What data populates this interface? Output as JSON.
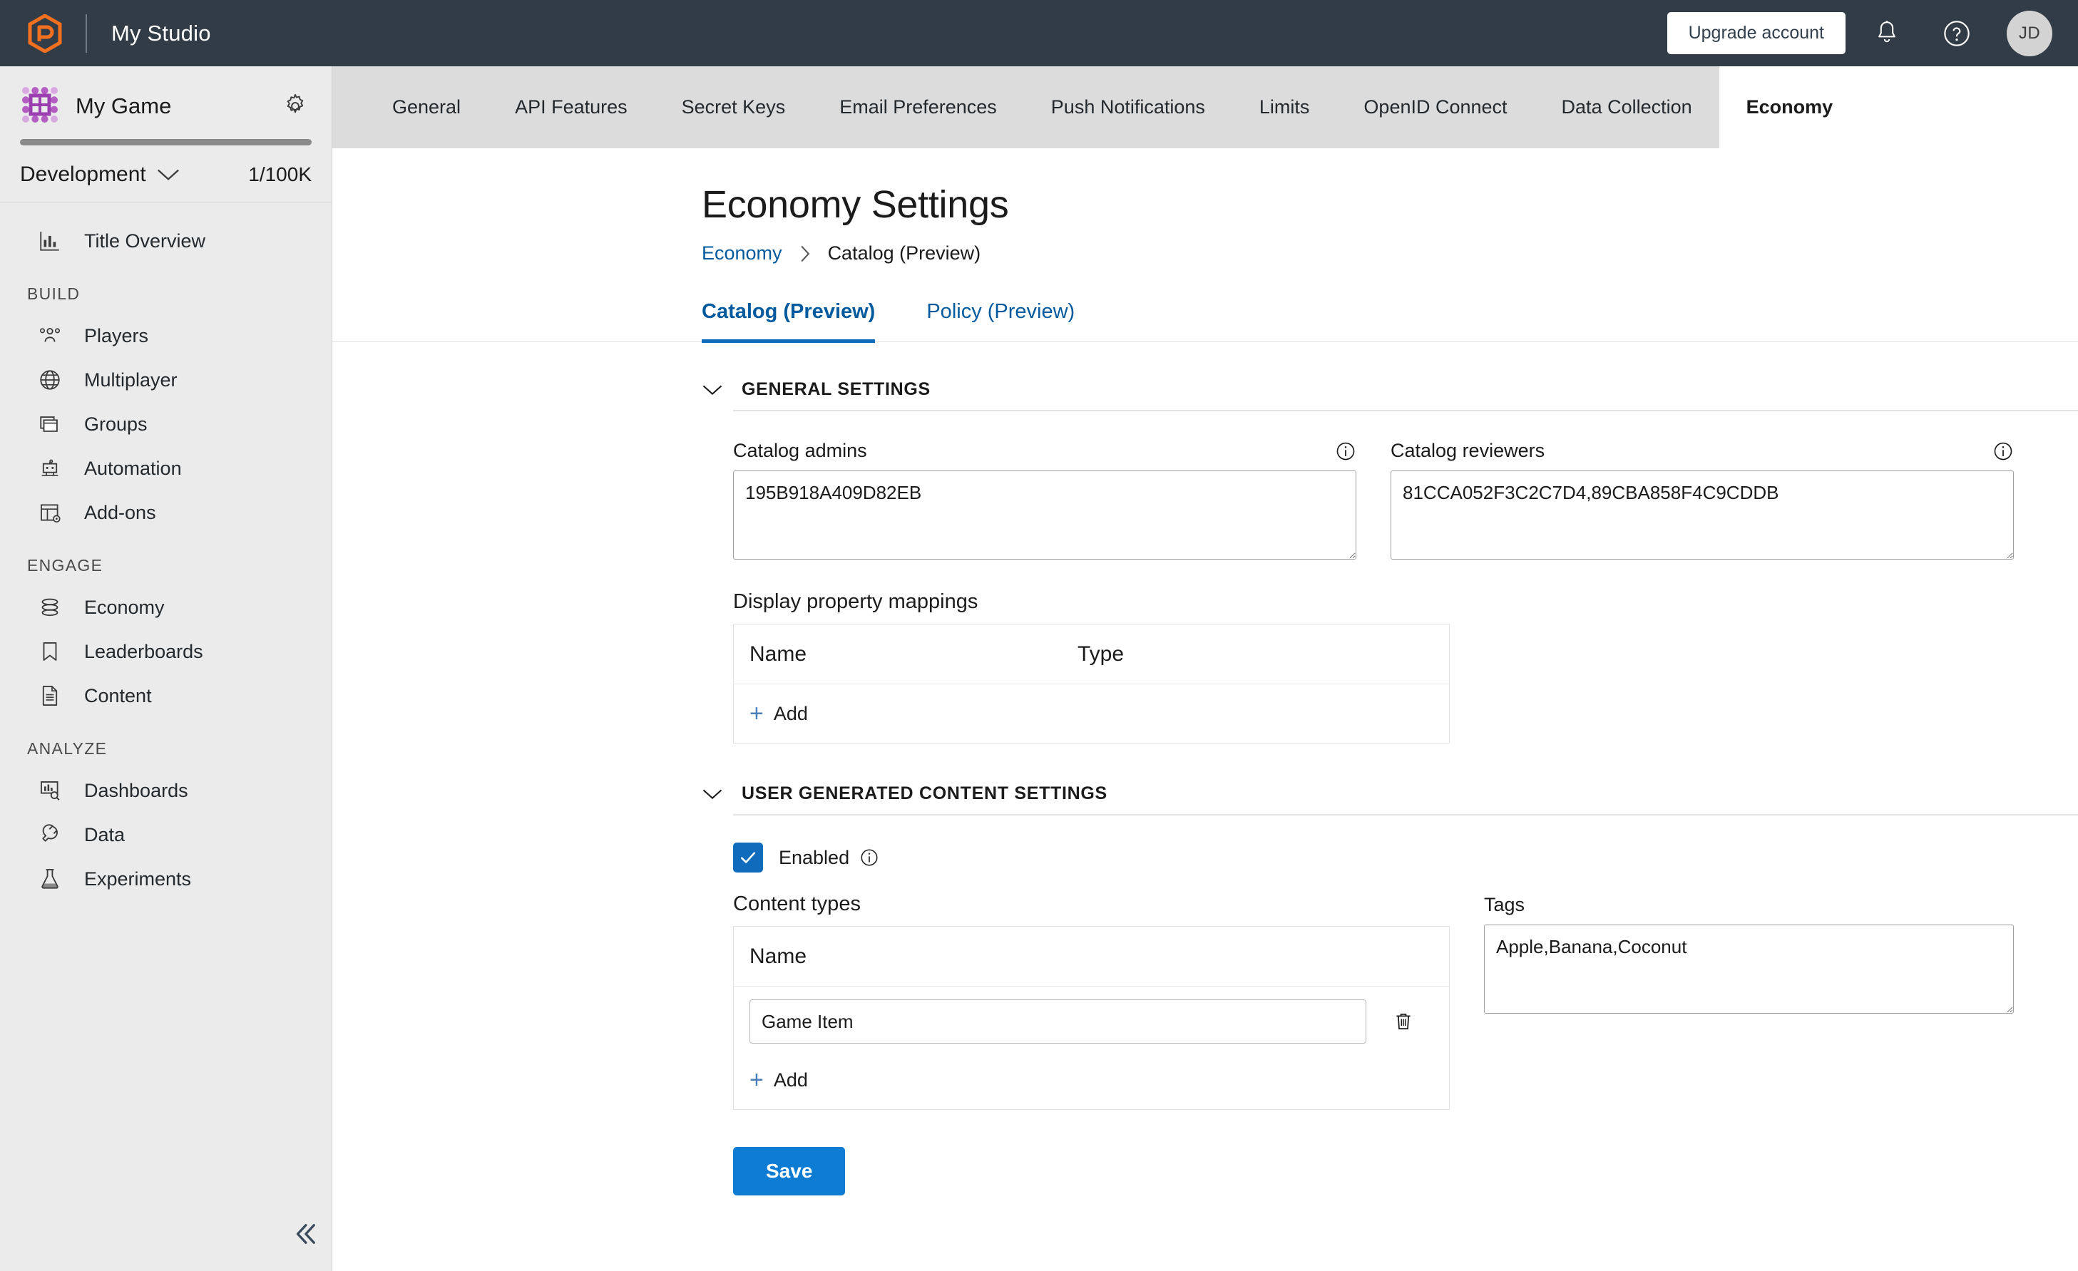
{
  "header": {
    "logo_icon": "playfab-hexagon-logo",
    "studio_name": "My Studio",
    "upgrade_label": "Upgrade account",
    "bell_icon": "bell-icon",
    "help_icon": "help-circle-icon",
    "avatar_initials": "JD",
    "brand_color": "#f2701f",
    "bar_color": "#323c47"
  },
  "sidebar": {
    "game_icon": "game-grid-icon",
    "game_name": "My Game",
    "gear_icon": "gear-icon",
    "environment": "Development",
    "environment_chevron_icon": "chevron-down-icon",
    "quota": "1/100K",
    "top_items": [
      {
        "label": "Title Overview",
        "icon": "bar-chart-icon"
      }
    ],
    "groups": [
      {
        "label": "BUILD",
        "items": [
          {
            "label": "Players",
            "icon": "people-icon"
          },
          {
            "label": "Multiplayer",
            "icon": "globe-icon"
          },
          {
            "label": "Groups",
            "icon": "stacked-windows-icon"
          },
          {
            "label": "Automation",
            "icon": "robot-icon"
          },
          {
            "label": "Add-ons",
            "icon": "addons-grid-gear-icon"
          }
        ]
      },
      {
        "label": "ENGAGE",
        "items": [
          {
            "label": "Economy",
            "icon": "coins-stack-icon"
          },
          {
            "label": "Leaderboards",
            "icon": "bookmark-icon"
          },
          {
            "label": "Content",
            "icon": "document-icon"
          }
        ]
      },
      {
        "label": "ANALYZE",
        "items": [
          {
            "label": "Dashboards",
            "icon": "dashboard-search-icon"
          },
          {
            "label": "Data",
            "icon": "plug-icon"
          },
          {
            "label": "Experiments",
            "icon": "flask-icon"
          }
        ]
      }
    ],
    "collapse_icon": "double-chevron-left-icon"
  },
  "tabs": [
    {
      "label": "General",
      "active": false
    },
    {
      "label": "API Features",
      "active": false
    },
    {
      "label": "Secret Keys",
      "active": false
    },
    {
      "label": "Email Preferences",
      "active": false
    },
    {
      "label": "Push Notifications",
      "active": false
    },
    {
      "label": "Limits",
      "active": false
    },
    {
      "label": "OpenID Connect",
      "active": false
    },
    {
      "label": "Data Collection",
      "active": false
    },
    {
      "label": "Economy",
      "active": true
    }
  ],
  "page": {
    "title": "Economy Settings",
    "breadcrumb": {
      "root": "Economy",
      "separator_icon": "chevron-right-icon",
      "current": "Catalog (Preview)"
    },
    "subtabs": [
      {
        "label": "Catalog (Preview)",
        "active": true
      },
      {
        "label": "Policy (Preview)",
        "active": false
      }
    ],
    "accent_color": "#0f6cbd"
  },
  "general_settings": {
    "section_title": "GENERAL SETTINGS",
    "collapse_icon": "chevron-down-icon",
    "catalog_admins": {
      "label": "Catalog admins",
      "info_icon": "info-icon",
      "value": "195B918A409D82EB",
      "placeholder": ""
    },
    "catalog_reviewers": {
      "label": "Catalog reviewers",
      "info_icon": "info-icon",
      "value": "81CCA052F3C2C7D4,89CBA858F4C9CDDB",
      "placeholder": ""
    },
    "display_property_mappings": {
      "label": "Display property mappings",
      "columns": [
        "Name",
        "Type"
      ],
      "rows": [],
      "add_label": "Add",
      "add_icon": "plus-icon"
    }
  },
  "ugc_settings": {
    "section_title": "USER GENERATED CONTENT SETTINGS",
    "collapse_icon": "chevron-down-icon",
    "enabled": {
      "label": "Enabled",
      "checked": true,
      "check_icon": "checkmark-icon",
      "info_icon": "info-icon"
    },
    "content_types": {
      "label": "Content types",
      "column": "Name",
      "rows": [
        {
          "value": "Game Item",
          "delete_icon": "trash-icon"
        }
      ],
      "add_label": "Add",
      "add_icon": "plus-icon"
    },
    "tags": {
      "label": "Tags",
      "value": "Apple,Banana,Coconut",
      "placeholder": ""
    }
  },
  "actions": {
    "save_label": "Save"
  }
}
